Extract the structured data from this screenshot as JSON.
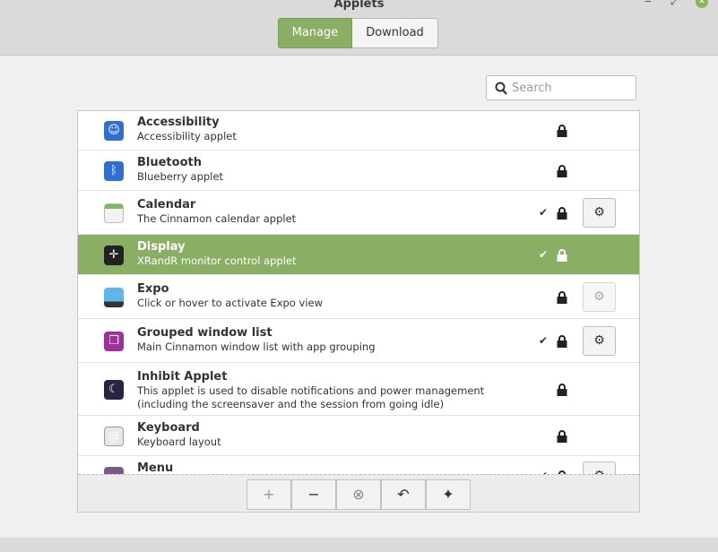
{
  "window": {
    "title": "Applets",
    "minimize": "‒",
    "maximize": "⤢",
    "close": "✕"
  },
  "tabs": [
    {
      "label": "Manage",
      "active": true
    },
    {
      "label": "Download",
      "active": false
    }
  ],
  "search": {
    "placeholder": "Search",
    "value": ""
  },
  "accent": "#8aae64",
  "applets": [
    {
      "name": "Accessibility",
      "desc": "Accessibility applet",
      "icon": "accessibility-icon",
      "enabled": false,
      "settings": false
    },
    {
      "name": "Bluetooth",
      "desc": "Blueberry applet",
      "icon": "bluetooth-icon",
      "enabled": false,
      "settings": false
    },
    {
      "name": "Calendar",
      "desc": "The Cinnamon calendar applet",
      "icon": "calendar-icon",
      "enabled": true,
      "settings": true
    },
    {
      "name": "Display",
      "desc": "XRandR monitor control applet",
      "icon": "display-icon",
      "enabled": true,
      "settings": false,
      "selected": true
    },
    {
      "name": "Expo",
      "desc": "Click or hover to activate Expo view",
      "icon": "expo-icon",
      "enabled": false,
      "settings": "disabled"
    },
    {
      "name": "Grouped window list",
      "desc": "Main Cinnamon window list with app grouping",
      "icon": "window-list-icon",
      "enabled": true,
      "settings": true
    },
    {
      "name": "Inhibit Applet",
      "desc": "This applet is used to disable notifications and power management (including the screensaver and the session from going idle)",
      "icon": "moon-icon",
      "enabled": false,
      "settings": false
    },
    {
      "name": "Keyboard",
      "desc": "Keyboard layout",
      "icon": "keyboard-icon",
      "enabled": false,
      "settings": false
    },
    {
      "name": "Menu",
      "desc": "",
      "icon": "menu-icon",
      "enabled": true,
      "settings": true
    }
  ],
  "toolbar": {
    "add": "+",
    "remove": "−",
    "clear": "⊗",
    "undo": "↶",
    "more": "✦"
  },
  "glyphs": {
    "check": "✔",
    "gear": "⚙"
  }
}
